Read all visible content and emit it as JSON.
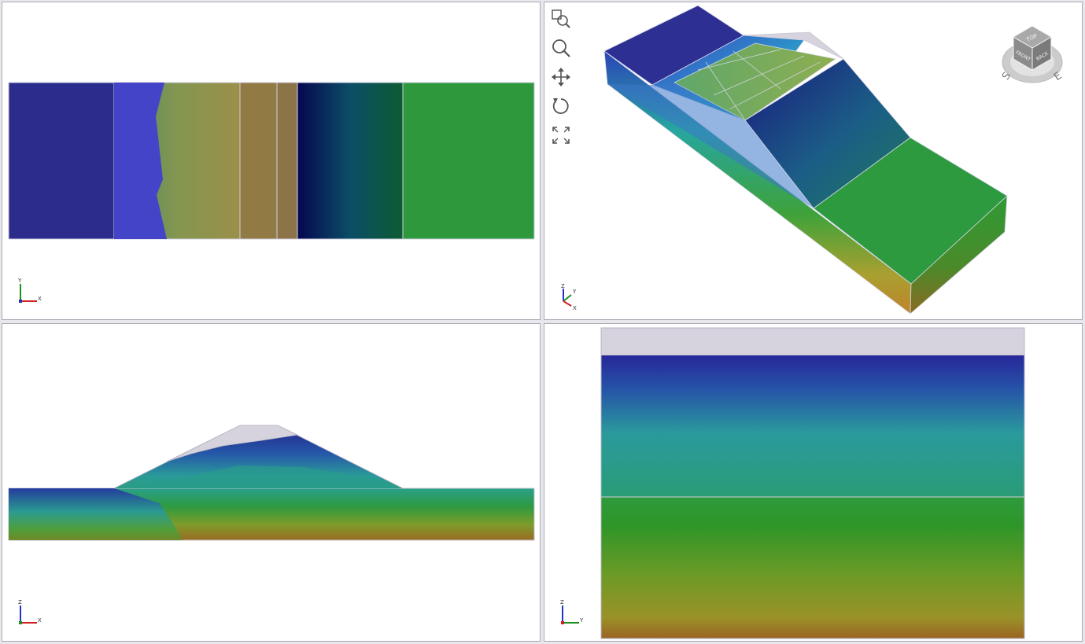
{
  "viewports": {
    "top": {
      "triad": {
        "axis1": "Y",
        "axis2": "X"
      }
    },
    "iso": {
      "triad": {
        "axis1": "Z",
        "axis2": "Y",
        "axis3": "X"
      },
      "toolbar": [
        "zoom-window-icon",
        "zoom-icon",
        "pan-icon",
        "rotate-icon",
        "zoom-extents-icon"
      ],
      "view_cube": {
        "top": "TOP",
        "front": "FRONT",
        "back": "BACK",
        "compass_s": "S",
        "compass_e": "E"
      }
    },
    "front": {
      "triad": {
        "axis1": "Z",
        "axis2": "X"
      }
    },
    "side": {
      "triad": {
        "axis1": "Z",
        "axis2": "Y"
      }
    }
  },
  "colors": {
    "background": "#e8e8ec",
    "panel": "#ffffff",
    "border": "#a9a9b4",
    "contour_high": "#2b2c8f",
    "contour_mid": "#2b9a96",
    "contour_green": "#2e9831",
    "contour_low": "#956a24",
    "unsaturated": "#d6d3de"
  }
}
